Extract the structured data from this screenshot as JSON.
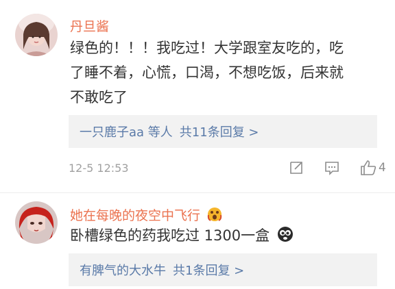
{
  "comments": [
    {
      "username": "丹旦酱",
      "lines": [
        "绿色的！！！我吃过！大学跟室友吃的，吃",
        "了睡不着，心慌，口渴，不想吃饭，后来就",
        "不敢吃了"
      ],
      "replies": {
        "who": "一只鹿子aa 等人",
        "count": "共11条回复 >"
      },
      "timestamp": "12-5 12:53",
      "like_count": "4"
    },
    {
      "username": "她在每晚的夜空中飞行",
      "text": "卧槽绿色的药我吃过 1300一盒",
      "replies": {
        "who": "有脾气的大水牛",
        "count": "共1条回复 >"
      }
    }
  ],
  "colors": {
    "username": "#eb7350",
    "link": "#5a7aa8",
    "meta": "#a0a0a0",
    "reply_bg": "#f2f2f2"
  },
  "icons": [
    "share-icon",
    "comment-icon",
    "like-icon",
    "emoji-icon"
  ]
}
